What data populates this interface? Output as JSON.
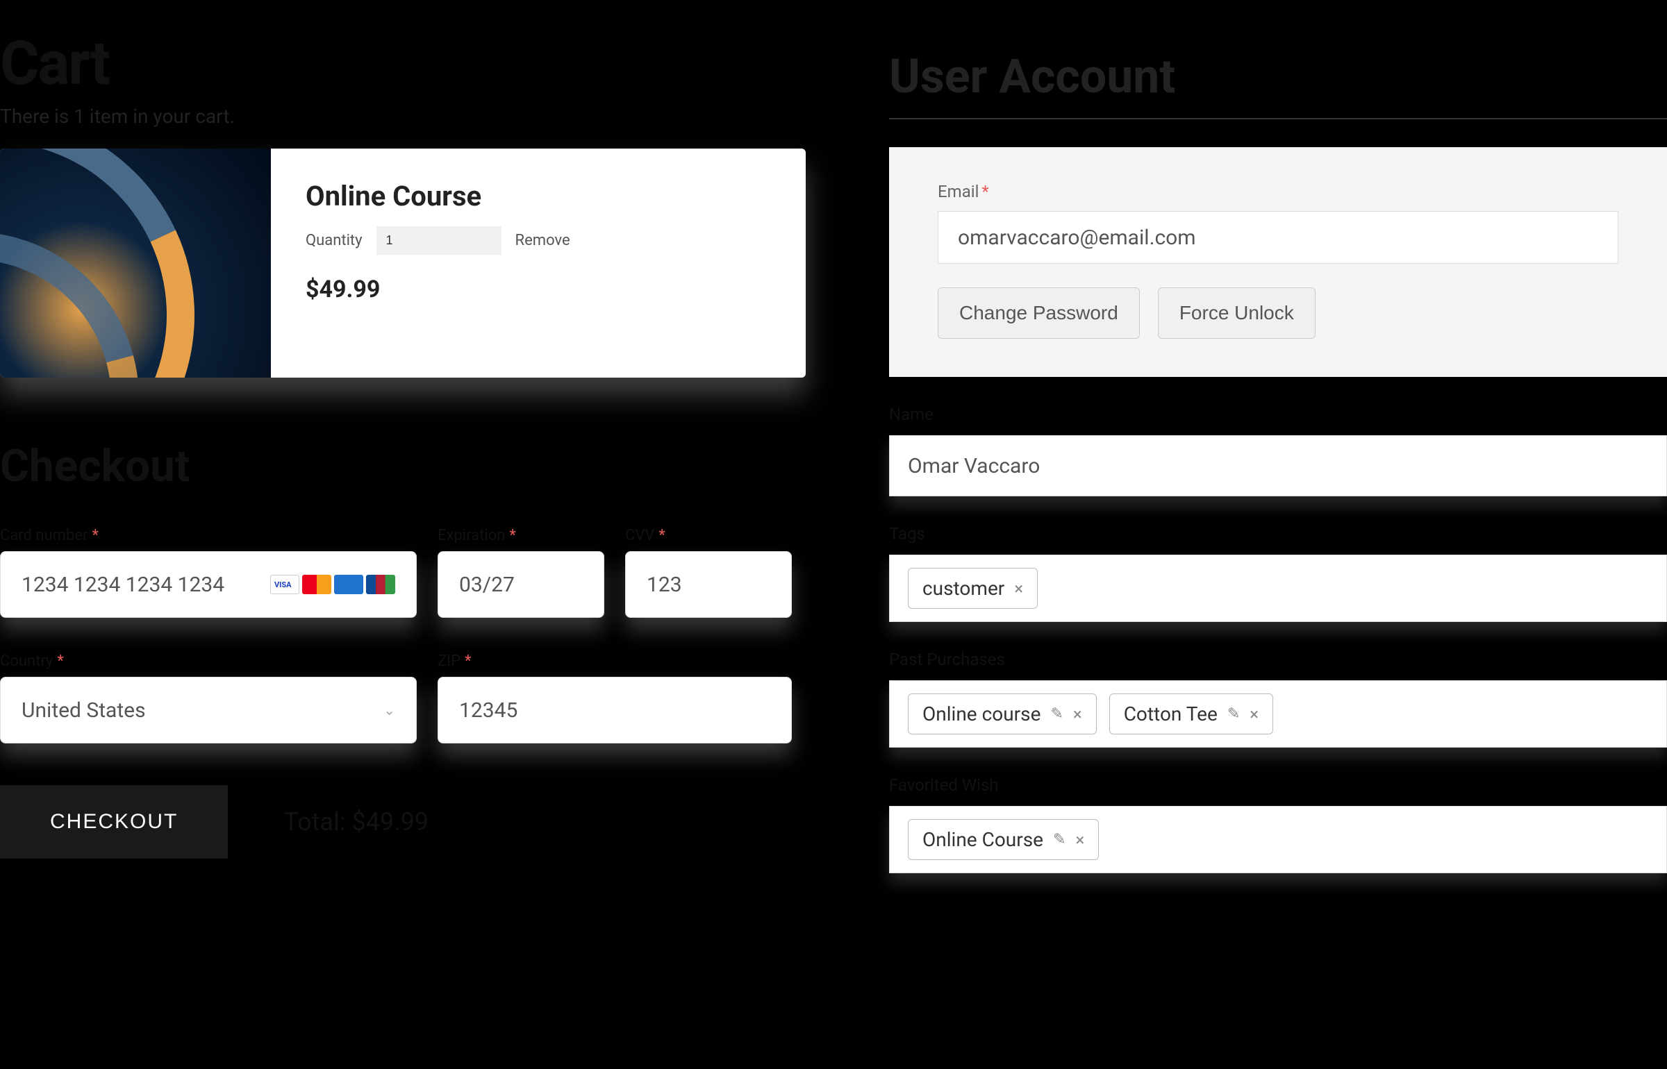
{
  "cart": {
    "heading": "Cart",
    "subtitle": "There is 1 item in your cart.",
    "item": {
      "title": "Online Course",
      "quantity_label": "Quantity",
      "quantity_value": "1",
      "remove_label": "Remove",
      "price": "$49.99"
    }
  },
  "checkout": {
    "heading": "Checkout",
    "card_number_label": "Card number",
    "card_number_value": "1234 1234 1234 1234",
    "expiration_label": "Expiration",
    "expiration_value": "03/27",
    "cvv_label": "CVV",
    "cvv_value": "123",
    "country_label": "Country",
    "country_value": "United States",
    "zip_label": "ZIP",
    "zip_value": "12345",
    "button_label": "CHECKOUT",
    "total_text": "Total: $49.99"
  },
  "account": {
    "heading": "User Account",
    "email_label": "Email",
    "email_value": "omarvaccaro@email.com",
    "change_password_label": "Change Password",
    "force_unlock_label": "Force Unlock",
    "name_label": "Name",
    "name_value": "Omar Vaccaro",
    "tags_label": "Tags",
    "tags": [
      "customer"
    ],
    "past_purchases_label": "Past Purchases",
    "past_purchases": [
      "Online course",
      "Cotton Tee"
    ],
    "favorited_label": "Favorited Wish",
    "favorited": [
      "Online Course"
    ]
  }
}
